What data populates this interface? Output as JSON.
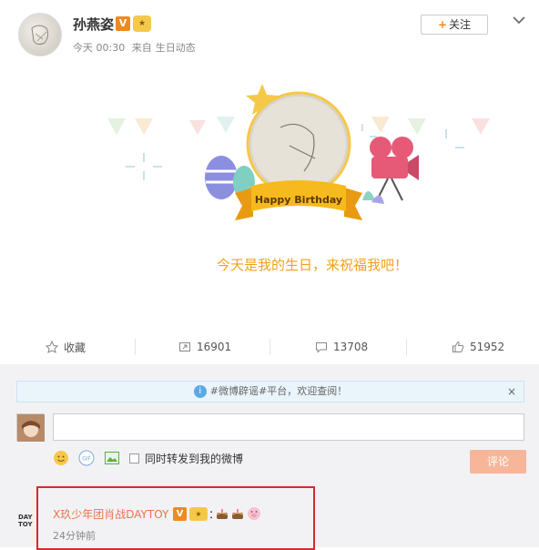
{
  "post": {
    "username": "孙燕姿",
    "v_badge": "V",
    "meta_time": "今天 00:30",
    "meta_from": "来自",
    "meta_source": "生日动态",
    "follow_label": "关注",
    "follow_plus": "+"
  },
  "card": {
    "ribbon_text": "Happy Birthday",
    "message": "今天是我的生日，来祝福我吧！"
  },
  "actions": {
    "favorite_label": "收藏",
    "repost_count": "16901",
    "comment_count": "13708",
    "like_count": "51952"
  },
  "comments": {
    "notice_text": "#微博辟谣#平台，欢迎查阅！",
    "notice_close": "×",
    "also_repost_label": "同时转发到我的微博",
    "submit_label": "评论",
    "first": {
      "logo_text": "DAY TOY",
      "author": "X玖少年团肖战DAYTOY",
      "v_badge": "V",
      "colon": "：",
      "time": "24分钟前"
    }
  },
  "colors": {
    "accent_orange": "#f08a1d",
    "birthday_text": "#f0a21b",
    "highlight_red": "#d62a2a",
    "commenter_link": "#eb7350"
  }
}
